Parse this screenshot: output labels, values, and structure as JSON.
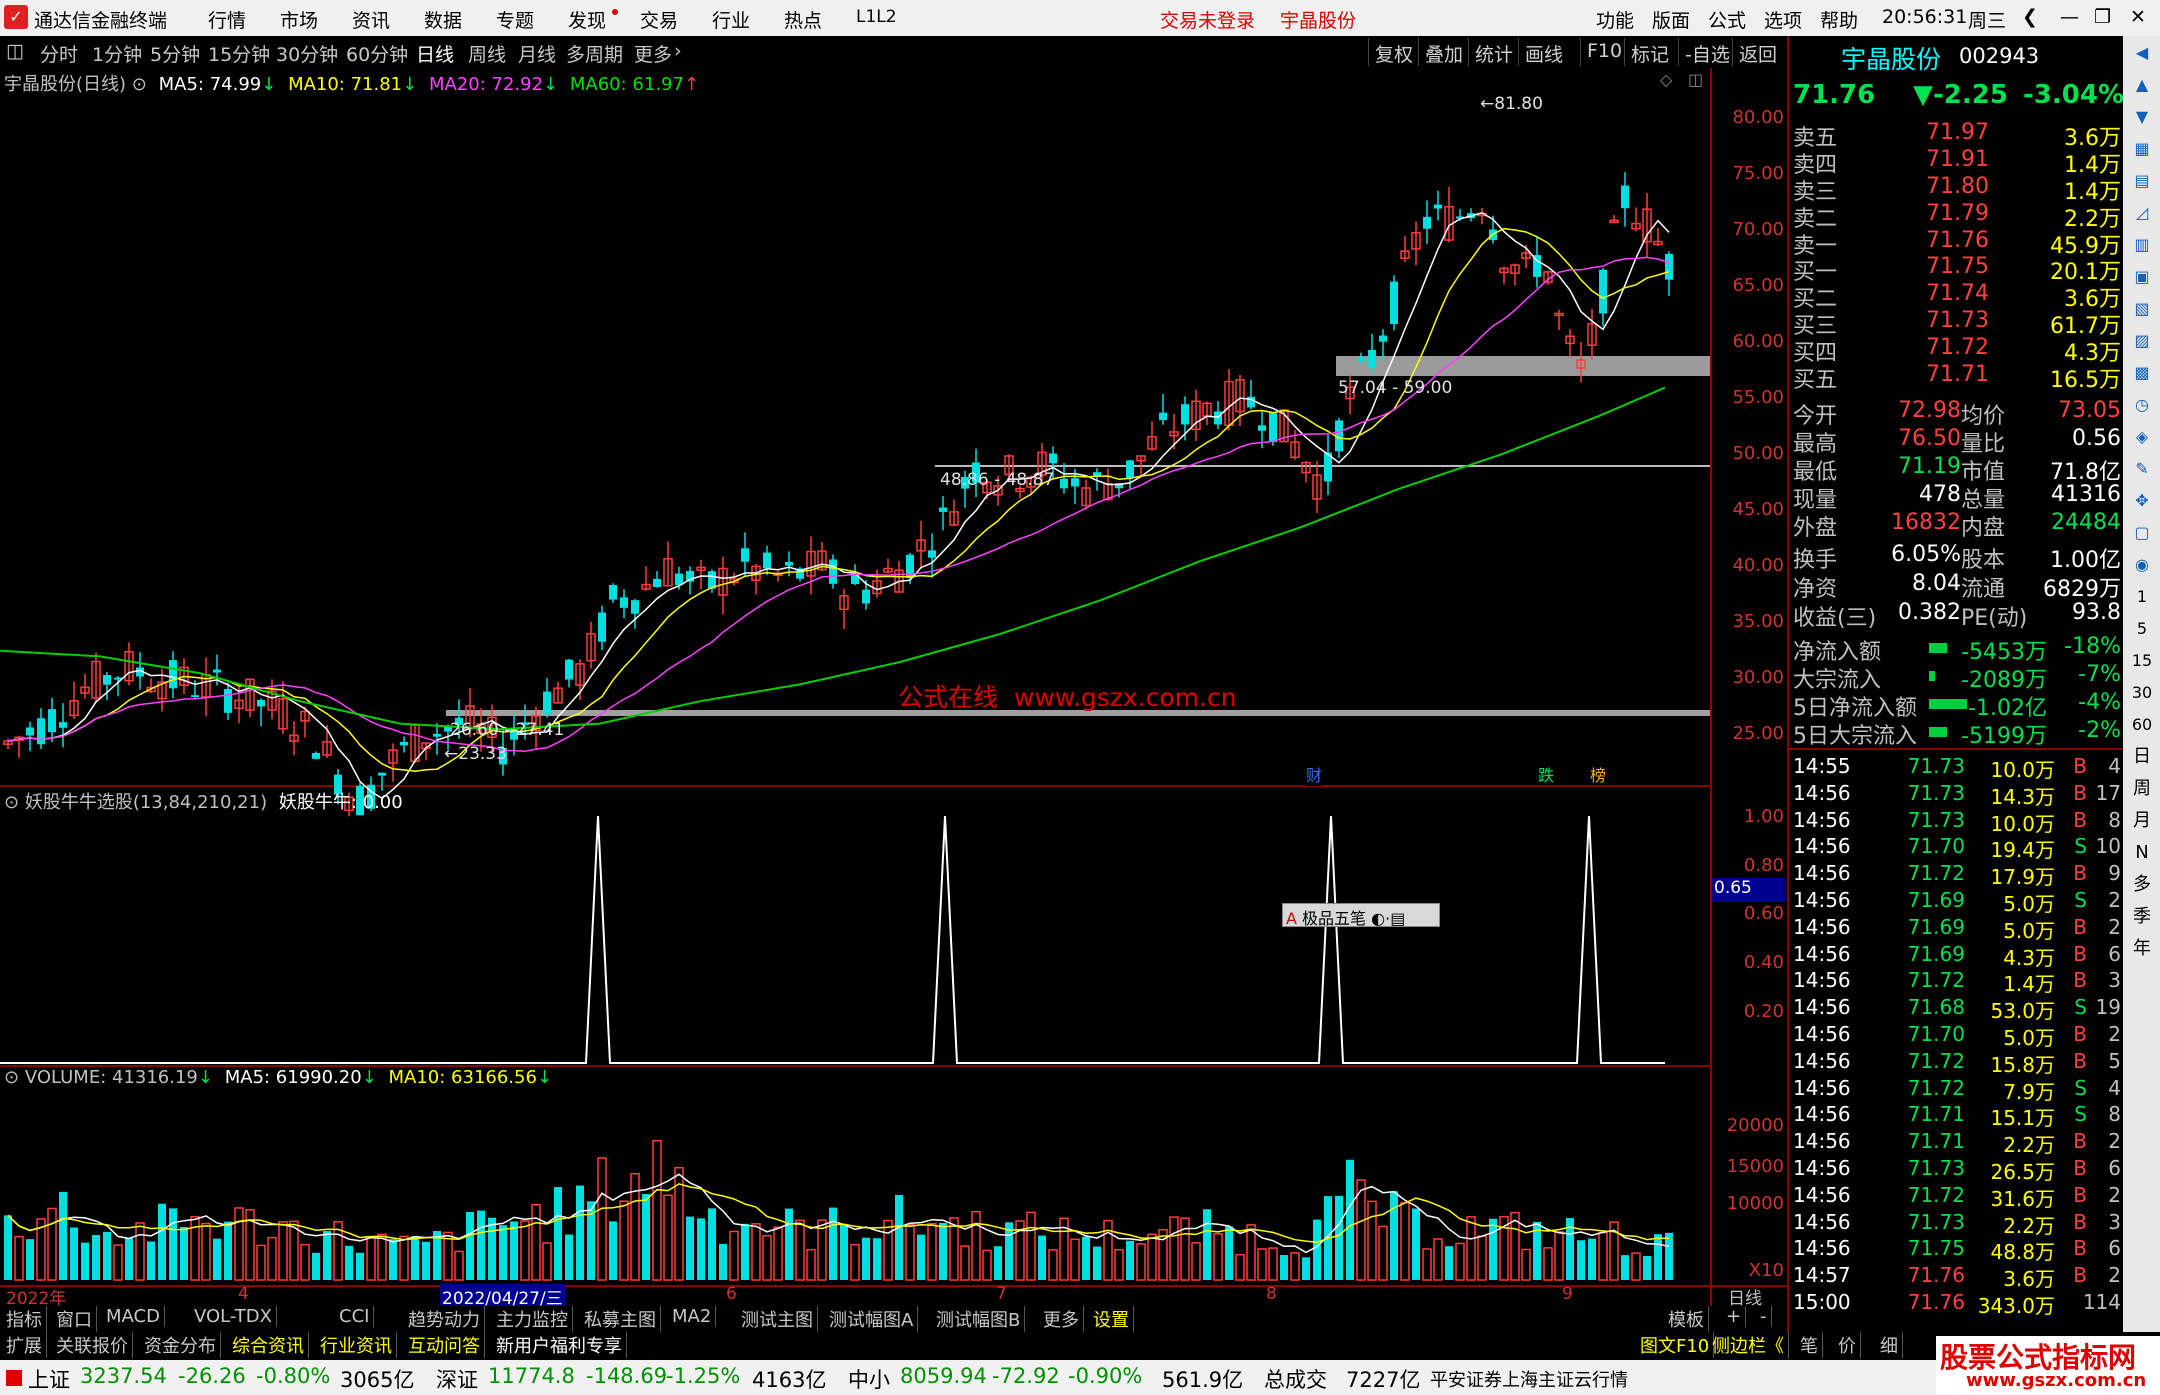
{
  "app": {
    "logo_text": "通达信金融终端",
    "menus": [
      "行情",
      "市场",
      "资讯",
      "数据",
      "专题",
      "发现",
      "交易",
      "行业",
      "热点",
      "L1L2"
    ],
    "login_status": "交易未登录",
    "stock_name_top": "宇晶股份",
    "right_menus": [
      "功能",
      "版面",
      "公式",
      "选项",
      "帮助"
    ],
    "clock": "20:56:31",
    "weekday": "周三"
  },
  "periods": [
    "分时",
    "1分钟",
    "5分钟",
    "15分钟",
    "30分钟",
    "60分钟",
    "日线",
    "周线",
    "月线",
    "多周期",
    "更多"
  ],
  "toolbar": [
    "复权",
    "叠加",
    "统计",
    "画线",
    "F10",
    "标记",
    "-自选",
    "返回"
  ],
  "main_chart": {
    "title": "宇晶股份(日线)",
    "ma5": "MA5: 74.99",
    "ma10": "MA10: 71.81",
    "ma20": "MA20: 72.92",
    "ma60": "MA60: 61.97",
    "y_ticks": [
      "80.00",
      "75.00",
      "70.00",
      "65.00",
      "60.00",
      "55.00",
      "50.00",
      "45.00",
      "40.00",
      "35.00",
      "30.00",
      "25.00"
    ],
    "annotations": {
      "high": "81.80",
      "low": "23.33",
      "zone1": "26.60 - 27.41",
      "zone2": "48.86 - 48.87",
      "zone3": "57.04 - 59.00"
    },
    "watermark": "公式在线  www.gszx.com.cn",
    "markers": [
      "财",
      "跌",
      "榜"
    ]
  },
  "chart_data": [
    {
      "type": "line",
      "title": "宇晶股份(日线)",
      "ylim": [
        23.33,
        81.8
      ],
      "x": [
        "2022-03-01",
        "2022-04-27",
        "2022-06-01",
        "2022-07-01",
        "2022-08-01",
        "2022-09-01",
        "2022-09-07"
      ],
      "series": [
        {
          "name": "close (approx)",
          "values": [
            30,
            24.5,
            45,
            44,
            57,
            80,
            71.76
          ]
        }
      ]
    },
    {
      "type": "line",
      "title": "妖股牛牛选股(13,84,210,21)",
      "ylim": [
        0,
        1
      ],
      "series": [
        {
          "name": "妖股牛牛",
          "values": [
            0,
            1,
            0,
            1,
            0,
            1,
            0,
            1,
            0
          ]
        }
      ]
    },
    {
      "type": "bar",
      "title": "VOLUME",
      "ylim": [
        0,
        25000
      ],
      "series": [
        {
          "name": "VOLUME",
          "values": [
            10000,
            13000,
            8000,
            21000,
            9000,
            14000,
            12000,
            16000,
            11000,
            20000,
            9000,
            8000,
            6000
          ]
        }
      ]
    }
  ],
  "indicator": {
    "title": "妖股牛牛选股(13,84,210,21)",
    "value": "妖股牛牛: 0.00",
    "y_ticks": [
      "1.00",
      "0.80",
      "0.60",
      "0.40",
      "0.20"
    ],
    "cursor_value": "0.65",
    "tool_label": "极品五笔"
  },
  "volume": {
    "title": "VOLUME: 41316.19",
    "ma5": "MA5: 61990.20",
    "ma10": "MA10: 63166.56",
    "y_ticks": [
      "20000",
      "15000",
      "10000"
    ],
    "unit": "X10"
  },
  "x_axis": {
    "labels": [
      "2022年",
      "4",
      "2022/04/27/三",
      "6",
      "7",
      "8",
      "9"
    ],
    "right": "日线"
  },
  "quote": {
    "name": "宇晶股份",
    "code": "002943",
    "price": "71.76",
    "change": "▼-2.25",
    "pct": "-3.04%",
    "asks": [
      {
        "l": "卖五",
        "p": "71.97",
        "v": "3.6万"
      },
      {
        "l": "卖四",
        "p": "71.91",
        "v": "1.4万"
      },
      {
        "l": "卖三",
        "p": "71.80",
        "v": "1.4万"
      },
      {
        "l": "卖二",
        "p": "71.79",
        "v": "2.2万"
      },
      {
        "l": "卖一",
        "p": "71.76",
        "v": "45.9万"
      }
    ],
    "bids": [
      {
        "l": "买一",
        "p": "71.75",
        "v": "20.1万"
      },
      {
        "l": "买二",
        "p": "71.74",
        "v": "3.6万"
      },
      {
        "l": "买三",
        "p": "71.73",
        "v": "61.7万"
      },
      {
        "l": "买四",
        "p": "71.72",
        "v": "4.3万"
      },
      {
        "l": "买五",
        "p": "71.71",
        "v": "16.5万"
      }
    ],
    "stats": [
      {
        "a": "今开",
        "av": "72.98",
        "b": "均价",
        "bv": "73.05"
      },
      {
        "a": "最高",
        "av": "76.50",
        "b": "量比",
        "bv": "0.56"
      },
      {
        "a": "最低",
        "av": "71.19",
        "b": "市值",
        "bv": "71.8亿"
      },
      {
        "a": "现量",
        "av": "478",
        "b": "总量",
        "bv": "41316"
      },
      {
        "a": "外盘",
        "av": "16832",
        "b": "内盘",
        "bv": "24484"
      }
    ],
    "stats2": [
      {
        "a": "换手",
        "av": "6.05%",
        "b": "股本",
        "bv": "1.00亿"
      },
      {
        "a": "净资",
        "av": "8.04",
        "b": "流通",
        "bv": "6829万"
      },
      {
        "a": "收益(三)",
        "av": "0.382",
        "b": "PE(动)",
        "bv": "93.8"
      }
    ],
    "flows": [
      {
        "l": "净流入额",
        "v": "-5453万",
        "p": "-18%"
      },
      {
        "l": "大宗流入",
        "v": "-2089万",
        "p": "-7%"
      },
      {
        "l": "5日净流入额",
        "v": "-1.02亿",
        "p": "-4%"
      },
      {
        "l": "5日大宗流入",
        "v": "-5199万",
        "p": "-2%"
      }
    ],
    "ticks": [
      {
        "t": "14:55",
        "p": "71.73",
        "v": "10.0万",
        "s": "B",
        "n": "4"
      },
      {
        "t": "14:56",
        "p": "71.73",
        "v": "14.3万",
        "s": "B",
        "n": "17"
      },
      {
        "t": "14:56",
        "p": "71.73",
        "v": "10.0万",
        "s": "B",
        "n": "8"
      },
      {
        "t": "14:56",
        "p": "71.70",
        "v": "19.4万",
        "s": "S",
        "n": "10"
      },
      {
        "t": "14:56",
        "p": "71.72",
        "v": "17.9万",
        "s": "B",
        "n": "9"
      },
      {
        "t": "14:56",
        "p": "71.69",
        "v": "5.0万",
        "s": "S",
        "n": "2"
      },
      {
        "t": "14:56",
        "p": "71.69",
        "v": "5.0万",
        "s": "B",
        "n": "2"
      },
      {
        "t": "14:56",
        "p": "71.69",
        "v": "4.3万",
        "s": "B",
        "n": "6"
      },
      {
        "t": "14:56",
        "p": "71.72",
        "v": "1.4万",
        "s": "B",
        "n": "3"
      },
      {
        "t": "14:56",
        "p": "71.68",
        "v": "53.0万",
        "s": "S",
        "n": "19"
      },
      {
        "t": "14:56",
        "p": "71.70",
        "v": "5.0万",
        "s": "B",
        "n": "2"
      },
      {
        "t": "14:56",
        "p": "71.72",
        "v": "15.8万",
        "s": "B",
        "n": "5"
      },
      {
        "t": "14:56",
        "p": "71.72",
        "v": "7.9万",
        "s": "S",
        "n": "4"
      },
      {
        "t": "14:56",
        "p": "71.71",
        "v": "15.1万",
        "s": "S",
        "n": "8"
      },
      {
        "t": "14:56",
        "p": "71.71",
        "v": "2.2万",
        "s": "B",
        "n": "2"
      },
      {
        "t": "14:56",
        "p": "71.73",
        "v": "26.5万",
        "s": "B",
        "n": "6"
      },
      {
        "t": "14:56",
        "p": "71.72",
        "v": "31.6万",
        "s": "B",
        "n": "2"
      },
      {
        "t": "14:56",
        "p": "71.73",
        "v": "2.2万",
        "s": "B",
        "n": "3"
      },
      {
        "t": "14:56",
        "p": "71.75",
        "v": "48.8万",
        "s": "B",
        "n": "6"
      },
      {
        "t": "14:57",
        "p": "71.76",
        "v": "3.6万",
        "s": "B",
        "n": "2"
      },
      {
        "t": "15:00",
        "p": "71.76",
        "v": "343.0万",
        "s": "",
        "n": "114"
      }
    ]
  },
  "side_icons": [
    "日",
    "周",
    "月",
    "N",
    "多",
    "季",
    "年"
  ],
  "side_nums": [
    "1",
    "5",
    "15",
    "30",
    "60"
  ],
  "bottom_tabs1": [
    "指标",
    "窗口",
    "MACD",
    "VOL-TDX",
    "CCI",
    "趋势动力",
    "主力监控",
    "私募主图",
    "MA2",
    "测试主图",
    "测试幅图A",
    "测试幅图B",
    "更多",
    "设置"
  ],
  "bottom_tabs1_right": [
    "模板",
    "+",
    "-"
  ],
  "bottom_tabs2": [
    "扩展",
    "关联报价",
    "资金分布",
    "综合资讯",
    "行业资讯",
    "互动问答",
    "新用户福利专享"
  ],
  "bottom_tabs2_right": [
    "图文F10",
    "侧边栏《",
    "笔",
    "价",
    "细"
  ],
  "status": {
    "sh_label": "上证",
    "sh": "3237.54",
    "sh_chg": "-26.26",
    "sh_pct": "-0.80%",
    "sh_amt": "3065亿",
    "sz_label": "深证",
    "sz": "11774.8",
    "sz_chg": "-148.69",
    "sz_pct": "-1.25%",
    "sz_amt": "4163亿",
    "zx_label": "中小",
    "zx": "8059.94",
    "zx_chg": "-72.92",
    "zx_pct": "-0.90%",
    "zx_amt": "561.9亿",
    "total_label": "总成交",
    "total": "7227亿",
    "broker": "平安证券上海主证云行情",
    "brand": "股票公式指标网",
    "brand_url": "www.gszx.com.cn"
  }
}
